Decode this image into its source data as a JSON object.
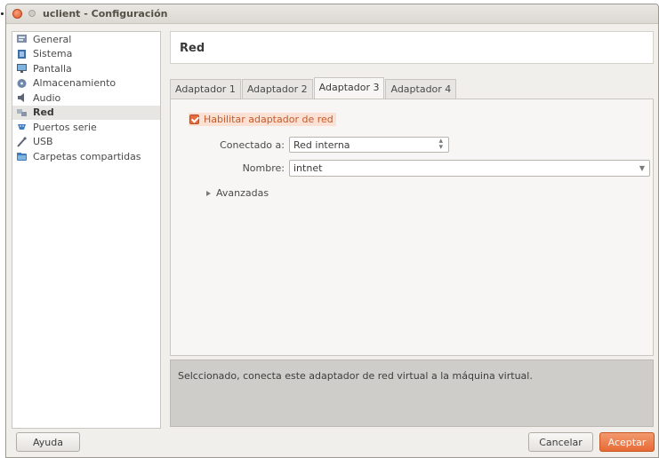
{
  "window": {
    "title": "uclient - Configuración"
  },
  "sidebar": {
    "items": [
      {
        "label": "General",
        "icon": "general-icon"
      },
      {
        "label": "Sistema",
        "icon": "chip-icon"
      },
      {
        "label": "Pantalla",
        "icon": "monitor-icon"
      },
      {
        "label": "Almacenamiento",
        "icon": "disk-icon"
      },
      {
        "label": "Audio",
        "icon": "speaker-icon"
      },
      {
        "label": "Red",
        "icon": "network-icon",
        "selected": true
      },
      {
        "label": "Puertos serie",
        "icon": "serial-port-icon"
      },
      {
        "label": "USB",
        "icon": "usb-icon"
      },
      {
        "label": "Carpetas compartidas",
        "icon": "folder-icon"
      }
    ]
  },
  "main": {
    "title": "Red",
    "tabs": [
      "Adaptador 1",
      "Adaptador 2",
      "Adaptador 3",
      "Adaptador 4"
    ],
    "active_tab_index": 2,
    "enable_checkbox": {
      "label": "Habilitar adaptador de red",
      "checked": true
    },
    "attached_to": {
      "label": "Conectado a:",
      "value": "Red interna"
    },
    "name": {
      "label": "Nombre:",
      "value": "intnet"
    },
    "advanced": {
      "label": "Avanzadas"
    }
  },
  "help_text": "Selccionado, conecta este adaptador de red virtual a la máquina virtual.",
  "buttons": {
    "help": "Ayuda",
    "cancel": "Cancelar",
    "accept": "Aceptar"
  },
  "colors": {
    "accent": "#e86b3b",
    "selected_bg": "#e8e6e2",
    "help_bg": "#cfcdc9"
  }
}
